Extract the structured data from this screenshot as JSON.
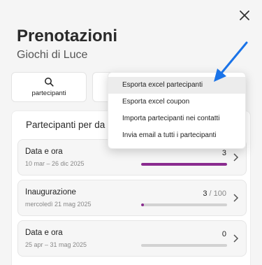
{
  "header": {
    "title": "Prenotazioni",
    "subtitle": "Giochi di Luce",
    "close_icon": "close-icon"
  },
  "actions": [
    {
      "label": "partecipanti",
      "icon": "search-icon"
    },
    {
      "label": "",
      "icon": ""
    }
  ],
  "section": {
    "title": "Partecipanti per da"
  },
  "cards": [
    {
      "title": "Data e ora",
      "dates": "10 mar – 26 dic 2025",
      "count": "3",
      "total": "",
      "progress": 1.0
    },
    {
      "title": "Inaugurazione",
      "dates": "mercoledì 21 mag 2025",
      "count": "3",
      "total": "/ 100",
      "progress": 0.03
    },
    {
      "title": "Data e ora",
      "dates": "25 apr – 31 mag 2025",
      "count": "0",
      "total": "",
      "progress": 0.0
    }
  ],
  "dropdown": {
    "items": [
      "Esporta excel partecipanti",
      "Esporta excel coupon",
      "Importa partecipanti nei contatti",
      "Invia email a tutti i partecipanti"
    ],
    "highlighted": "Esporta excel partecipanti"
  },
  "colors": {
    "accent": "#8a2b8f",
    "arrow": "#1a73e8",
    "track": "#d2d2d2"
  }
}
